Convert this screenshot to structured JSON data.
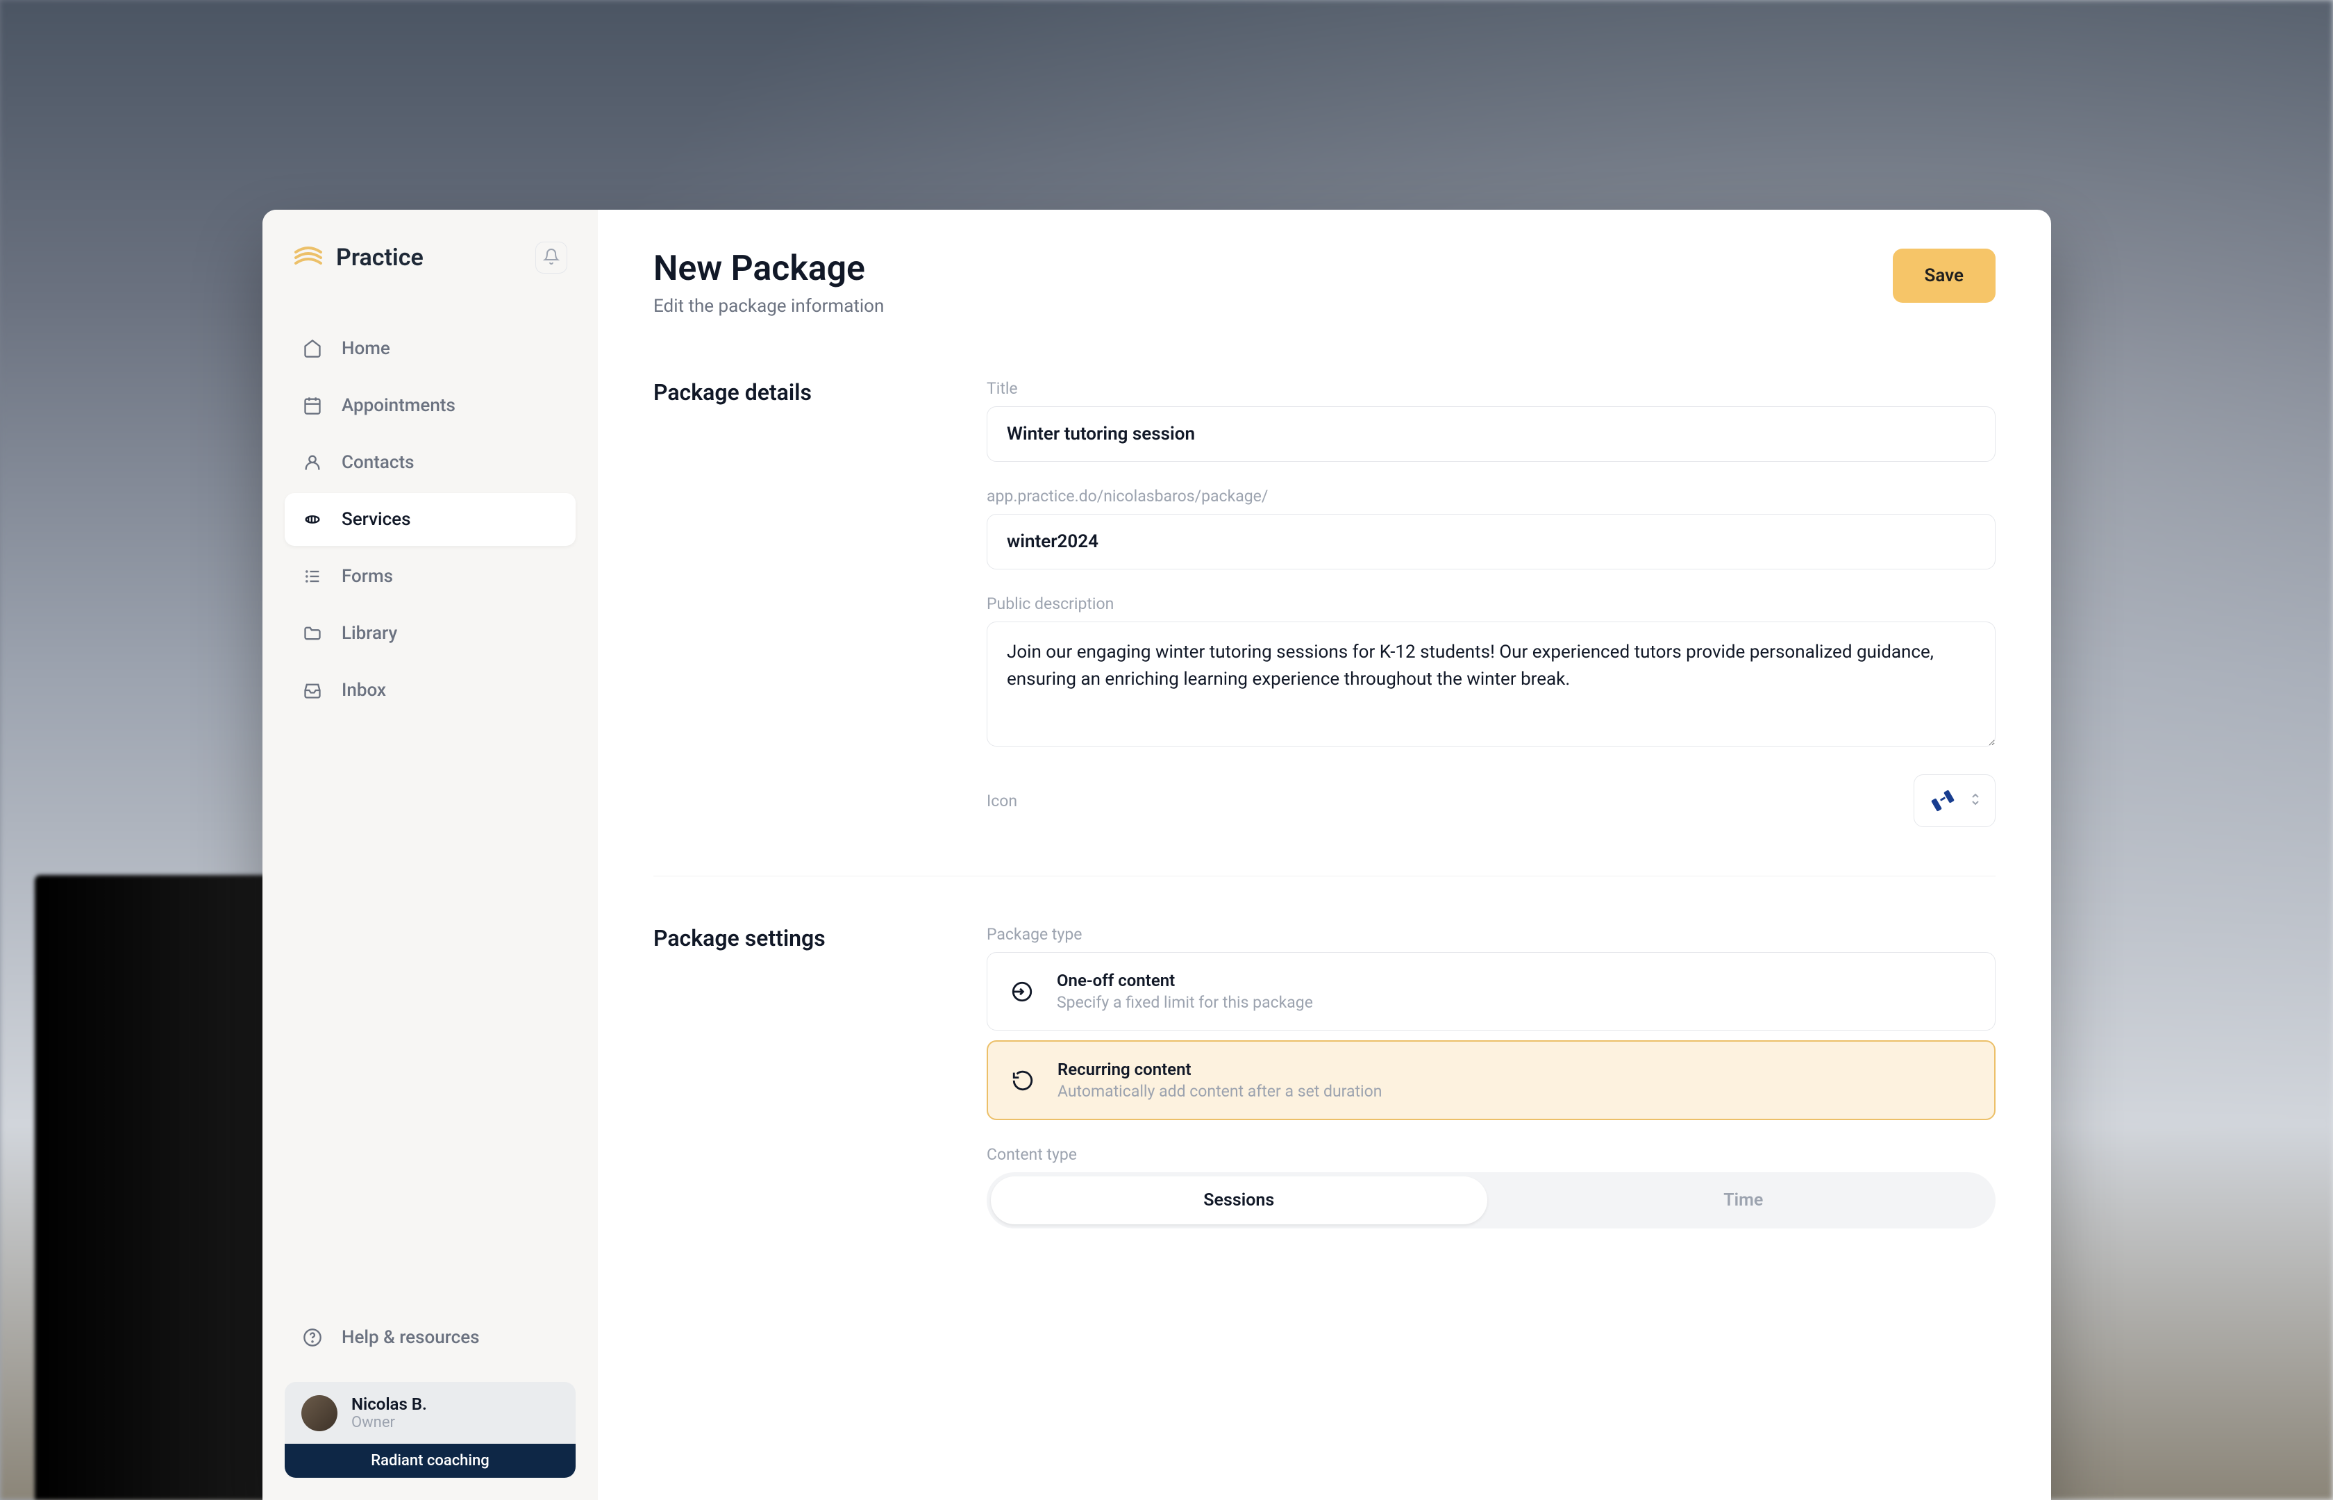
{
  "brand": {
    "name": "Practice"
  },
  "sidebar": {
    "items": [
      {
        "label": "Home"
      },
      {
        "label": "Appointments"
      },
      {
        "label": "Contacts"
      },
      {
        "label": "Services"
      },
      {
        "label": "Forms"
      },
      {
        "label": "Library"
      },
      {
        "label": "Inbox"
      }
    ],
    "help_label": "Help & resources",
    "user": {
      "name": "Nicolas B.",
      "role": "Owner",
      "company": "Radiant coaching"
    }
  },
  "header": {
    "title": "New Package",
    "subtitle": "Edit the package information",
    "save_label": "Save"
  },
  "details": {
    "section_title": "Package details",
    "title_label": "Title",
    "title_value": "Winter tutoring session",
    "url_label": "app.practice.do/nicolasbaros/package/",
    "slug_value": "winter2024",
    "description_label": "Public description",
    "description_value": "Join our engaging winter tutoring sessions for K-12 students! Our experienced tutors provide personalized guidance, ensuring an enriching learning experience throughout the winter break.",
    "icon_label": "Icon"
  },
  "settings": {
    "section_title": "Package settings",
    "type_label": "Package type",
    "oneoff_title": "One-off content",
    "oneoff_desc": "Specify a fixed limit for this package",
    "recurring_title": "Recurring content",
    "recurring_desc": "Automatically add content after a set duration",
    "content_type_label": "Content type",
    "sessions_label": "Sessions",
    "time_label": "Time"
  }
}
